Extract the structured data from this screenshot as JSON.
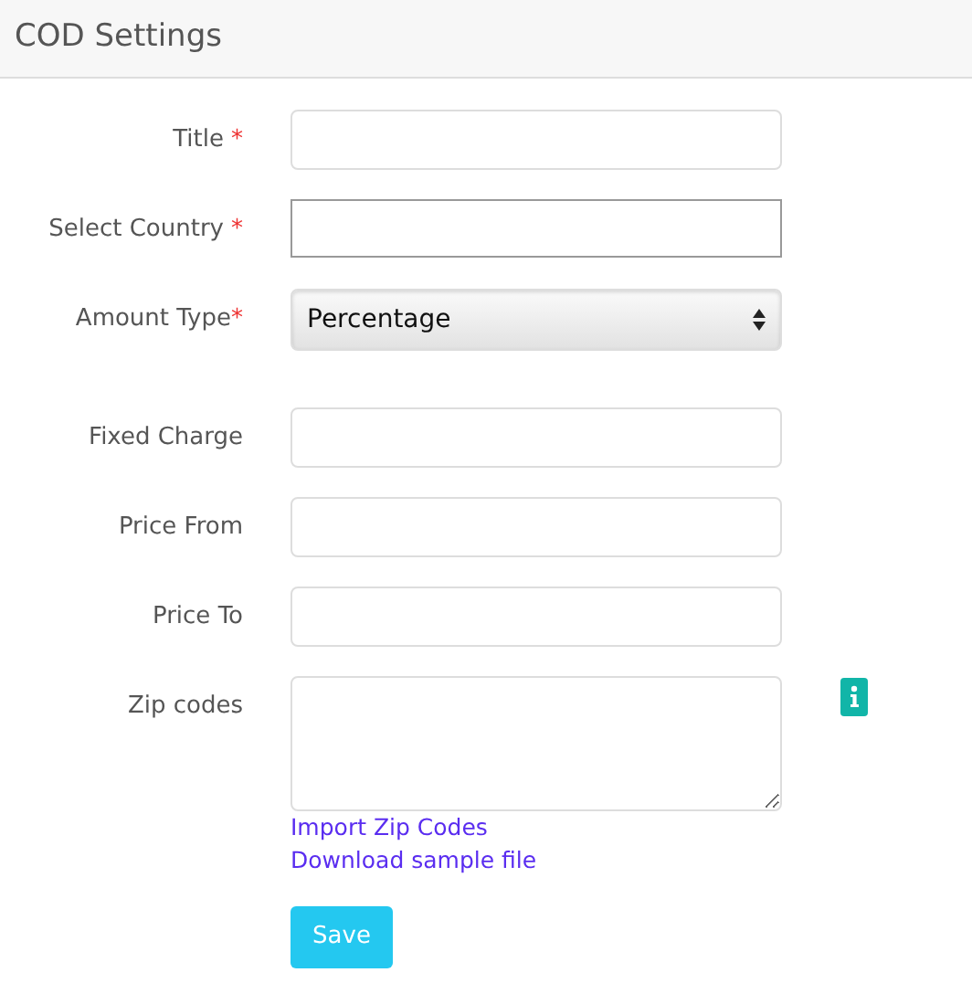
{
  "header": {
    "title": "COD Settings"
  },
  "fields": [
    {
      "kind": "text",
      "label": "Title",
      "required_mark": "*"
    },
    {
      "kind": "country",
      "label": "Select Country",
      "required_mark": "*"
    },
    {
      "kind": "select",
      "label": "Amount Type",
      "required_mark": "*",
      "value": "Percentage"
    },
    {
      "kind": "text",
      "label": "Fixed Charge"
    },
    {
      "kind": "text",
      "label": "Price From"
    },
    {
      "kind": "text",
      "label": "Price To"
    },
    {
      "kind": "textarea",
      "label": "Zip codes",
      "info": true
    }
  ],
  "links": [
    "Import Zip Codes",
    "Download sample file"
  ],
  "save_button": "Save"
}
